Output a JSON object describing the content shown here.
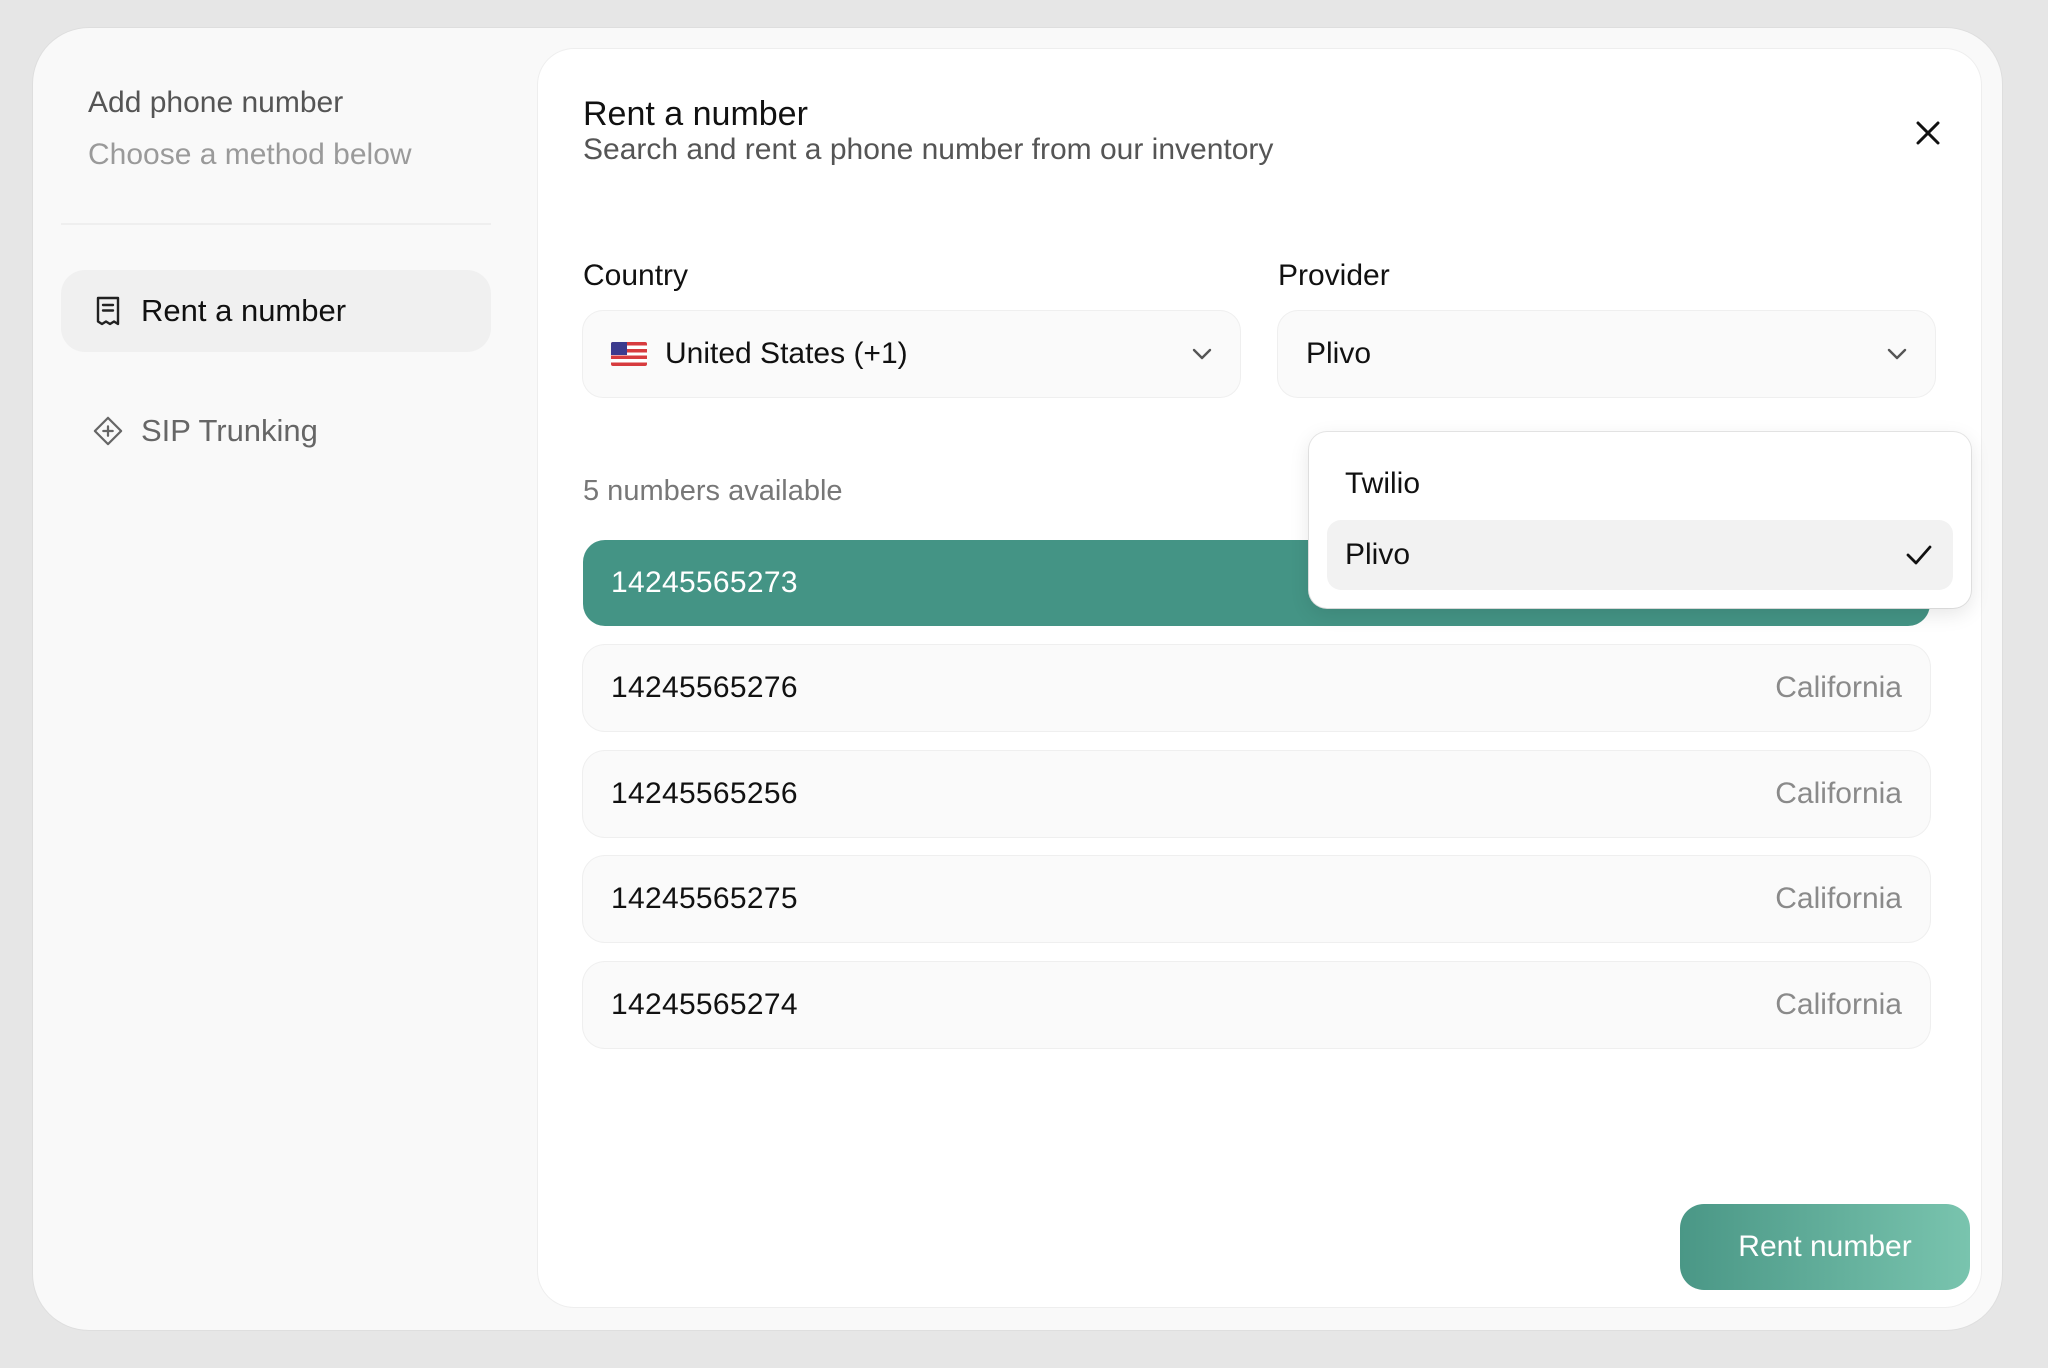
{
  "sidebar": {
    "title": "Add phone number",
    "subtitle": "Choose a method below",
    "items": [
      {
        "label": "Rent a number",
        "icon": "receipt-icon",
        "active": true
      },
      {
        "label": "SIP Trunking",
        "icon": "diamond-plus-icon",
        "active": false
      }
    ]
  },
  "panel": {
    "title": "Rent a number",
    "subtitle": "Search and rent a phone number from our inventory",
    "country": {
      "label": "Country",
      "value": "United States (+1)",
      "flag": "us-flag-icon"
    },
    "provider": {
      "label": "Provider",
      "value": "Plivo"
    },
    "available_text": "5 numbers available",
    "numbers": [
      {
        "number": "14245565273",
        "region": "",
        "selected": true
      },
      {
        "number": "14245565276",
        "region": "California",
        "selected": false
      },
      {
        "number": "14245565256",
        "region": "California",
        "selected": false
      },
      {
        "number": "14245565275",
        "region": "California",
        "selected": false
      },
      {
        "number": "14245565274",
        "region": "California",
        "selected": false
      }
    ],
    "rent_button": "Rent number"
  },
  "provider_dropdown": {
    "options": [
      {
        "label": "Twilio",
        "selected": false
      },
      {
        "label": "Plivo",
        "selected": true
      }
    ]
  },
  "colors": {
    "accent": "#449485",
    "button_gradient_start": "#4a9786",
    "button_gradient_end": "#79c4ae"
  }
}
